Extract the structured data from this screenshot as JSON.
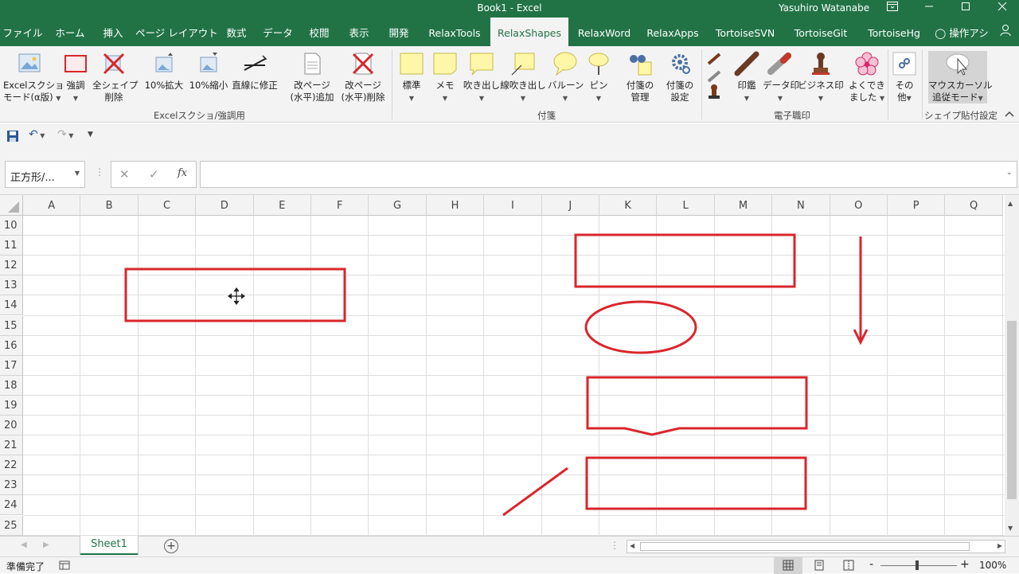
{
  "titlebar": {
    "doc_title": "Book1  -  Excel",
    "user": "Yasuhiro Watanabe",
    "ribbon_display_icon": "ribbon-display-options-icon",
    "minimize_icon": "minimize-icon",
    "maximize_icon": "maximize-icon",
    "close_icon": "close-icon"
  },
  "tabs": [
    "ファイル",
    "ホーム",
    "挿入",
    "ページ レイアウト",
    "数式",
    "データ",
    "校閲",
    "表示",
    "開発",
    "RelaxTools",
    "RelaxShapes",
    "RelaxWord",
    "RelaxApps",
    "TortoiseSVN",
    "TortoiseGit",
    "TortoiseHg",
    "操作アシ"
  ],
  "active_tab": "RelaxShapes",
  "ribbon": {
    "btn_screenshot": "Excelスクショ",
    "btn_screenshot2": "モード(α版)",
    "btn_emphasis": "強調",
    "btn_delete_shapes": "全シェイプ",
    "btn_delete_shapes2": "削除",
    "btn_zoom_in": "10%拡大",
    "btn_zoom_out": "10%縮小",
    "btn_straight": "直線に修正",
    "btn_pagebreak_add": "改ページ",
    "btn_pagebreak_add2": "(水平)追加",
    "btn_pagebreak_del": "改ページ",
    "btn_pagebreak_del2": "(水平)削除",
    "group_screenshot": "Excelスクショ/強調用",
    "btn_standard": "標準",
    "btn_memo": "メモ",
    "btn_callout": "吹き出し",
    "btn_line_callout": "線吹き出し",
    "btn_balloon": "バルーン",
    "btn_pin": "ピン",
    "btn_manage": "付箋の",
    "btn_manage2": "管理",
    "btn_settings": "付箋の",
    "btn_settings2": "設定",
    "group_sticky": "付箋",
    "btn_stamp": "印鑑",
    "btn_data_stamp": "データ印",
    "btn_business_stamp": "ビジネス印",
    "btn_frequent": "よくでき",
    "btn_frequent2": "ました",
    "group_stamp": "電子職印",
    "btn_other": "その",
    "btn_other2": "他",
    "btn_mouse": "マウスカーソル",
    "btn_mouse2": "追従モード",
    "group_paste": "シェイプ貼付設定"
  },
  "formula_bar": {
    "name_box": "正方形/...",
    "cancel_icon": "cancel-icon",
    "enter_icon": "enter-icon",
    "fx_label": "fx",
    "formula": ""
  },
  "columns": [
    "A",
    "B",
    "C",
    "D",
    "E",
    "F",
    "G",
    "H",
    "I",
    "J",
    "K",
    "L",
    "M",
    "N",
    "O",
    "P",
    "Q"
  ],
  "rows": [
    "10",
    "11",
    "12",
    "13",
    "14",
    "15",
    "16",
    "17",
    "18",
    "19",
    "20",
    "21",
    "22",
    "23",
    "24",
    "25"
  ],
  "sheets": [
    "Sheet1"
  ],
  "status": {
    "ready": "準備完了",
    "zoom": "100%",
    "minus": "-",
    "plus": "+"
  },
  "colors": {
    "excel_green": "#217346",
    "shape_red": "#d9262c"
  }
}
